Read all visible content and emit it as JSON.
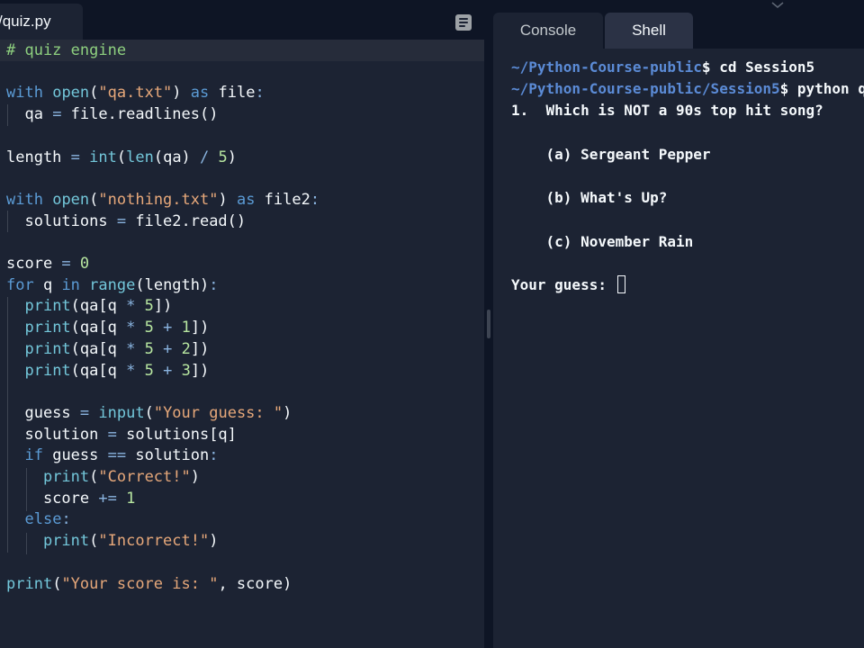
{
  "editor": {
    "file_tab": "/quiz.py",
    "lines": [
      "# quiz engine",
      "",
      "with open(\"qa.txt\") as file:",
      "  qa = file.readlines()",
      "",
      "length = int(len(qa) / 5)",
      "",
      "with open(\"nothing.txt\") as file2:",
      "  solutions = file2.read()",
      "",
      "score = 0",
      "for q in range(length):",
      "  print(qa[q * 5])",
      "  print(qa[q * 5 + 1])",
      "  print(qa[q * 5 + 2])",
      "  print(qa[q * 5 + 3])",
      "",
      "  guess = input(\"Your guess: \")",
      "  solution = solutions[q]",
      "  if guess == solution:",
      "    print(\"Correct!\")",
      "    score += 1",
      "  else:",
      "    print(\"Incorrect!\")",
      "",
      "print(\"Your score is: \", score)"
    ]
  },
  "terminal": {
    "tabs": [
      "Console",
      "Shell"
    ],
    "active_tab": "Shell",
    "prompt1_path": "~/Python-Course-public",
    "prompt1_cmd": "$ cd Session5",
    "prompt2_path": "~/Python-Course-public/Session5",
    "prompt2_cmd": "$ python quiz.py",
    "question": "1.  Which is NOT a 90s top hit song?",
    "option_a": "    (a) Sergeant Pepper",
    "option_b": "    (b) What's Up?",
    "option_c": "    (c) November Rain",
    "guess_prompt": "Your guess: "
  },
  "colors": {
    "background": "#0e1525",
    "editor_bg": "#1c2333",
    "path": "#5b8bd6"
  }
}
